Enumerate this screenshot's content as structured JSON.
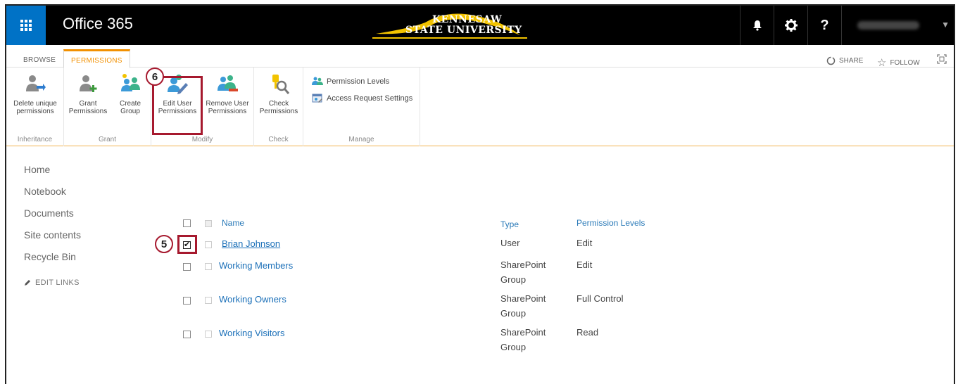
{
  "suitebar": {
    "brand": "Office 365",
    "logo_line1": "KENNESAW",
    "logo_line2": "STATE UNIVERSITY"
  },
  "tabs": {
    "browse": "BROWSE",
    "permissions": "PERMISSIONS",
    "share": "SHARE",
    "follow": "FOLLOW"
  },
  "ribbon": {
    "delete_unique_line1": "Delete unique",
    "delete_unique_line2": "permissions",
    "grant_permissions_line1": "Grant",
    "grant_permissions_line2": "Permissions",
    "create_group_line1": "Create",
    "create_group_line2": "Group",
    "edit_user_line1": "Edit User",
    "edit_user_line2": "Permissions",
    "remove_user_line1": "Remove User",
    "remove_user_line2": "Permissions",
    "check_line1": "Check",
    "check_line2": "Permissions",
    "permission_levels": "Permission Levels",
    "access_request": "Access Request Settings",
    "groups": {
      "inheritance": "Inheritance",
      "grant": "Grant",
      "modify": "Modify",
      "check": "Check",
      "manage": "Manage"
    }
  },
  "callouts": {
    "step5": "5",
    "step6": "6"
  },
  "leftnav": {
    "items": [
      "Home",
      "Notebook",
      "Documents",
      "Site contents",
      "Recycle Bin"
    ],
    "edit_links": "EDIT LINKS"
  },
  "list": {
    "headers": {
      "name": "Name",
      "type": "Type",
      "levels": "Permission Levels"
    },
    "rows": [
      {
        "name": "Brian Johnson",
        "type_line1": "User",
        "type_line2": "",
        "level": "Edit",
        "checked": true
      },
      {
        "name": "Working Members",
        "type_line1": "SharePoint",
        "type_line2": "Group",
        "level": "Edit",
        "checked": false
      },
      {
        "name": "Working Owners",
        "type_line1": "SharePoint",
        "type_line2": "Group",
        "level": "Full Control",
        "checked": false
      },
      {
        "name": "Working Visitors",
        "type_line1": "SharePoint",
        "type_line2": "Group",
        "level": "Read",
        "checked": false
      }
    ]
  },
  "colors": {
    "accent": "#f29000",
    "suitebar": "#000000",
    "waffle": "#0072c6",
    "callout": "#a6192e",
    "link": "#1a6fb8"
  }
}
